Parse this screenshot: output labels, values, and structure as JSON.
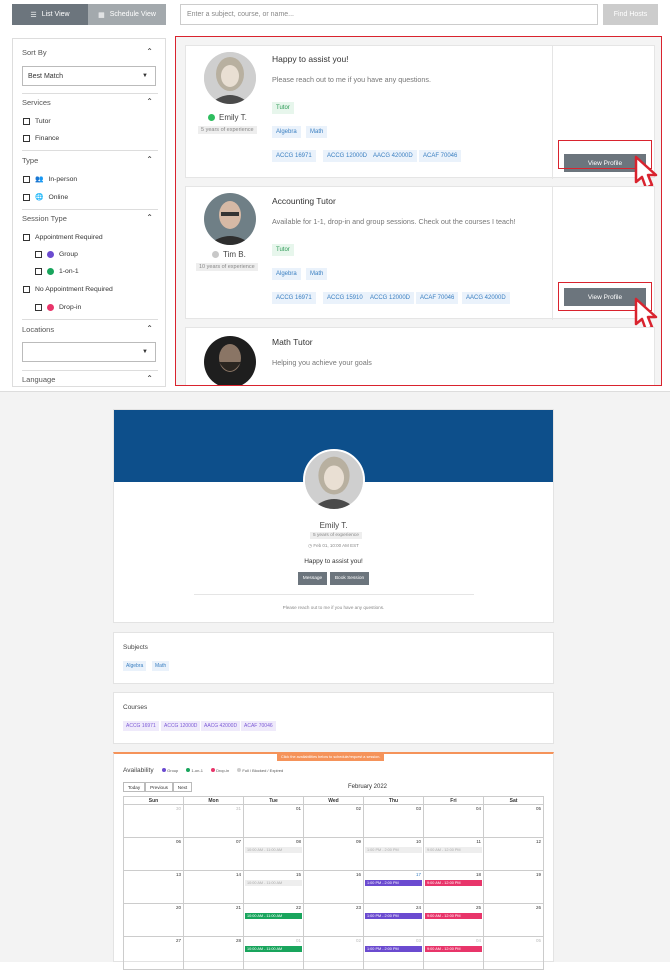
{
  "toolbar": {
    "list_view": "List View",
    "schedule_view": "Schedule View",
    "search_placeholder": "Enter a subject, course, or name...",
    "find_hosts": "Find Hosts"
  },
  "sidebar": {
    "sort_by": "Sort By",
    "sort_value": "Best Match",
    "services": "Services",
    "tutor": "Tutor",
    "finance": "Finance",
    "type": "Type",
    "in_person": "In-person",
    "online": "Online",
    "session_type": "Session Type",
    "appt_required": "Appointment Required",
    "group": "Group",
    "one_on_one": "1-on-1",
    "no_appt": "No Appointment Required",
    "drop_in": "Drop-in",
    "locations": "Locations",
    "language": "Language"
  },
  "hosts": [
    {
      "name": "Emily T.",
      "exp": "5 years of experience",
      "title": "Happy to assist you!",
      "desc": "Please reach out to me if you have any questions.",
      "service": "Tutor",
      "subjects": [
        "Algebra",
        "Math"
      ],
      "courses": [
        "ACCG 16971",
        "ACCG 12000D",
        "AACG 42000D",
        "ACAF 70046"
      ],
      "cta": "View Profile",
      "status": "online"
    },
    {
      "name": "Tim B.",
      "exp": "10 years of experience",
      "title": "Accounting Tutor",
      "desc": "Available for 1-1, drop-in and group sessions. Check out the courses I teach!",
      "service": "Tutor",
      "subjects": [
        "Algebra",
        "Math"
      ],
      "courses": [
        "ACCG 16971",
        "ACCG 15910",
        "ACCG 12000D",
        "ACAF 70046",
        "AACG 42000D"
      ],
      "cta": "View Profile",
      "status": "offline"
    },
    {
      "title": "Math Tutor",
      "desc": "Helping you achieve your goals"
    }
  ],
  "profile": {
    "name": "Emily T.",
    "exp": "5 years of experience",
    "timezone": "Feb 01, 10:00 AM EST",
    "headline": "Happy to assist you!",
    "message": "Message",
    "book": "Book Session",
    "about": "Please reach out to me if you have any questions.",
    "subjects_label": "Subjects",
    "subjects": [
      "Algebra",
      "Math"
    ],
    "courses_label": "Courses",
    "courses": [
      "ACCG 16971",
      "ACCG 12000D",
      "AACG 42000D",
      "ACAF 70046"
    ]
  },
  "availability": {
    "banner": "Click the availabilities below to schedule/request a session.",
    "label": "Availability",
    "legend": [
      "Group",
      "1-on-1",
      "Drop-in",
      "Full / Blocked / Expired"
    ],
    "today": "Today",
    "previous": "Previous",
    "next": "Next",
    "month": "February 2022",
    "days": [
      "Sun",
      "Mon",
      "Tue",
      "Wed",
      "Thu",
      "Fri",
      "Sat"
    ],
    "weeks": [
      [
        "30",
        "31",
        "01",
        "02",
        "03",
        "04",
        "05"
      ],
      [
        "06",
        "07",
        "08",
        "09",
        "10",
        "11",
        "12"
      ],
      [
        "13",
        "14",
        "15",
        "16",
        "17",
        "18",
        "19"
      ],
      [
        "20",
        "21",
        "22",
        "23",
        "24",
        "25",
        "26"
      ],
      [
        "27",
        "28",
        "01",
        "02",
        "03",
        "04",
        "05"
      ]
    ],
    "ev_gray": "10:00 AM - 11:00 AM",
    "ev_gray2": "1:00 PM - 2:00 PM",
    "ev_gray3": "9:00 AM - 12:00 PM",
    "ev_thu": "1:00 PM - 2:00 PM",
    "ev_fri": "9:00 AM - 12:00 PM",
    "ev_tue": "10:00 AM - 11:00 AM"
  },
  "colors": {
    "accent": "#0d4f8b",
    "highlight": "#d9232e",
    "group": "#6b4bd0",
    "one_on_one": "#19a55d",
    "drop_in": "#e8356a"
  }
}
